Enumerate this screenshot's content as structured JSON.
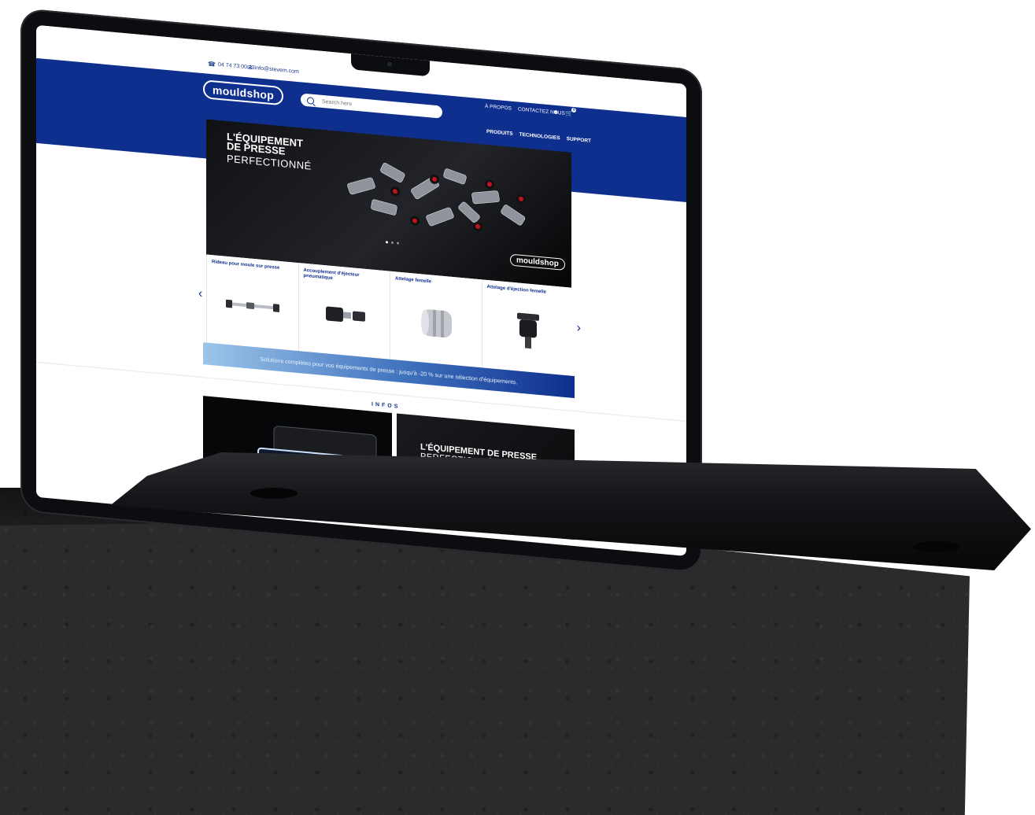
{
  "contact": {
    "phone": "04 74 73 00 33",
    "email": "info@stevem.com"
  },
  "header": {
    "logo": "mouldshop",
    "search_placeholder": "Search here",
    "top_links": [
      "À PROPOS",
      "CONTACTEZ NOUS"
    ],
    "cart_count": "0",
    "nav": [
      "PRODUITS",
      "TECHNOLOGIES",
      "SUPPORT"
    ]
  },
  "hero": {
    "line1": "L'ÉQUIPEMENT",
    "line2": "DE PRESSE",
    "line3": "PERFECTIONNÉ",
    "logo": "mouldshop"
  },
  "products": [
    {
      "name": "Rideau pour moule sur presse"
    },
    {
      "name": "Accouplement d'éjecteur pneumatique"
    },
    {
      "name": "Attelage femelle"
    },
    {
      "name": "Attelage d'éjection femelle"
    }
  ],
  "promo": "Solutions complètes pour vos équipements de presse : jusqu'à -20 % sur une sélection d'équipements.",
  "infos": {
    "label": "INFOS",
    "card2_line1": "L'ÉQUIPEMENT DE PRESSE",
    "card2_line2": "PERFECTIONNÉ"
  },
  "colors": {
    "brand_blue": "#0e2f8e",
    "promo_light": "#9cc5ea"
  }
}
